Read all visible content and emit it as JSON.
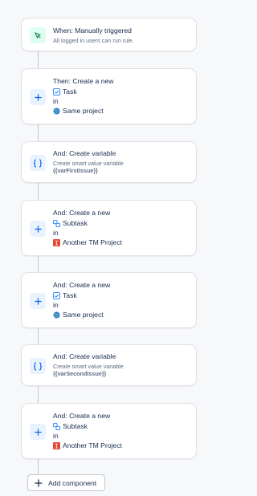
{
  "trigger": {
    "title": "When: Manually triggered",
    "subtitle": "All logged in users can run rule.",
    "icon": "cursor-click-icon"
  },
  "steps": [
    {
      "title": "Then: Create a new",
      "type_label": "Task",
      "type_icon": "task-checkbox-icon",
      "in_label": "in",
      "project_label": "Same project",
      "project_icon": "globe-icon"
    },
    {
      "title": "And: Create variable",
      "subtitle": "Create smart value variable",
      "value": "{{varFirstIssue}}",
      "icon": "braces-icon"
    },
    {
      "title": "And: Create a new",
      "type_label": "Subtask",
      "type_icon": "subtask-icon",
      "in_label": "in",
      "project_label": "Another TM Project",
      "project_icon": "project-avatar-icon"
    },
    {
      "title": "And: Create a new",
      "type_label": "Task",
      "type_icon": "task-checkbox-icon",
      "in_label": "in",
      "project_label": "Same project",
      "project_icon": "globe-icon"
    },
    {
      "title": "And: Create variable",
      "subtitle": "Create smart value variable",
      "value": "{{varSecondIssue}}",
      "icon": "braces-icon"
    },
    {
      "title": "And: Create a new",
      "type_label": "Subtask",
      "type_icon": "subtask-icon",
      "in_label": "in",
      "project_label": "Another TM Project",
      "project_icon": "project-avatar-icon"
    }
  ],
  "add_component": {
    "label": "Add component",
    "icon": "plus-icon"
  },
  "colors": {
    "trigger_badge": "#dcfff1",
    "trigger_icon": "#1f845a",
    "action_badge": "#e9f2ff",
    "action_icon": "#0c66e4",
    "task_icon": "#1d7afc",
    "project_red": "#e2483d"
  }
}
